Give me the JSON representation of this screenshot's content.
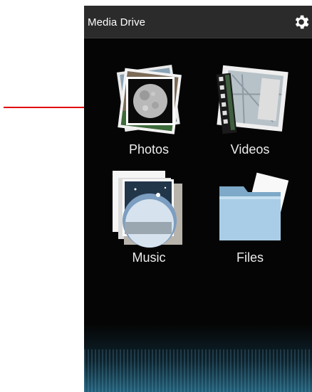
{
  "app": {
    "title": "Media Drive"
  },
  "tiles": [
    {
      "id": "photos",
      "label": "Photos"
    },
    {
      "id": "videos",
      "label": "Videos"
    },
    {
      "id": "music",
      "label": "Music"
    },
    {
      "id": "files",
      "label": "Files"
    }
  ],
  "icons": {
    "settings": "gear-icon",
    "annotation": "red-arrow"
  },
  "colors": {
    "background": "#050505",
    "titlebar": "#2b2b2b",
    "text": "#ffffff",
    "annotation_arrow": "#e00000",
    "folder": "#a9cde6"
  }
}
